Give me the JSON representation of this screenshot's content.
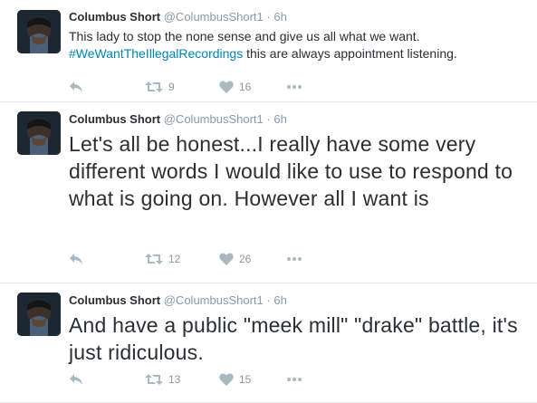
{
  "tweets": [
    {
      "fullname": "Columbus Short",
      "username": "@ColumbusShort1",
      "separator": "·",
      "time": "6h",
      "text_before": "This lady to stop the none sense and give us all what we want.",
      "hashtag": "#WeWantTheIllegalRecordings",
      "text_after": " this are always appointment listening.",
      "retweets": "9",
      "likes": "16",
      "icons": [
        "reply-icon",
        "retweet-icon",
        "heart-icon",
        "more-icon"
      ]
    },
    {
      "fullname": "Columbus Short",
      "username": "@ColumbusShort1",
      "separator": "·",
      "time": "6h",
      "text": "Let's all be honest...I really have some very different words I would like to use to respond to what is going on. However all I want is",
      "retweets": "12",
      "likes": "26",
      "icons": [
        "reply-icon",
        "retweet-icon",
        "heart-icon",
        "more-icon"
      ]
    },
    {
      "fullname": "Columbus Short",
      "username": "@ColumbusShort1",
      "separator": "·",
      "time": "6h",
      "text": "And have a public \"meek mill\" \"drake\" battle, it's just ridiculous.",
      "retweets": "13",
      "likes": "15",
      "icons": [
        "reply-icon",
        "retweet-icon",
        "heart-icon",
        "more-icon"
      ]
    }
  ],
  "colors": {
    "text": "#292f33",
    "muted": "#8899a6",
    "link": "#0084b4",
    "icon": "#aab8c2",
    "divider": "#e1e8ed"
  }
}
